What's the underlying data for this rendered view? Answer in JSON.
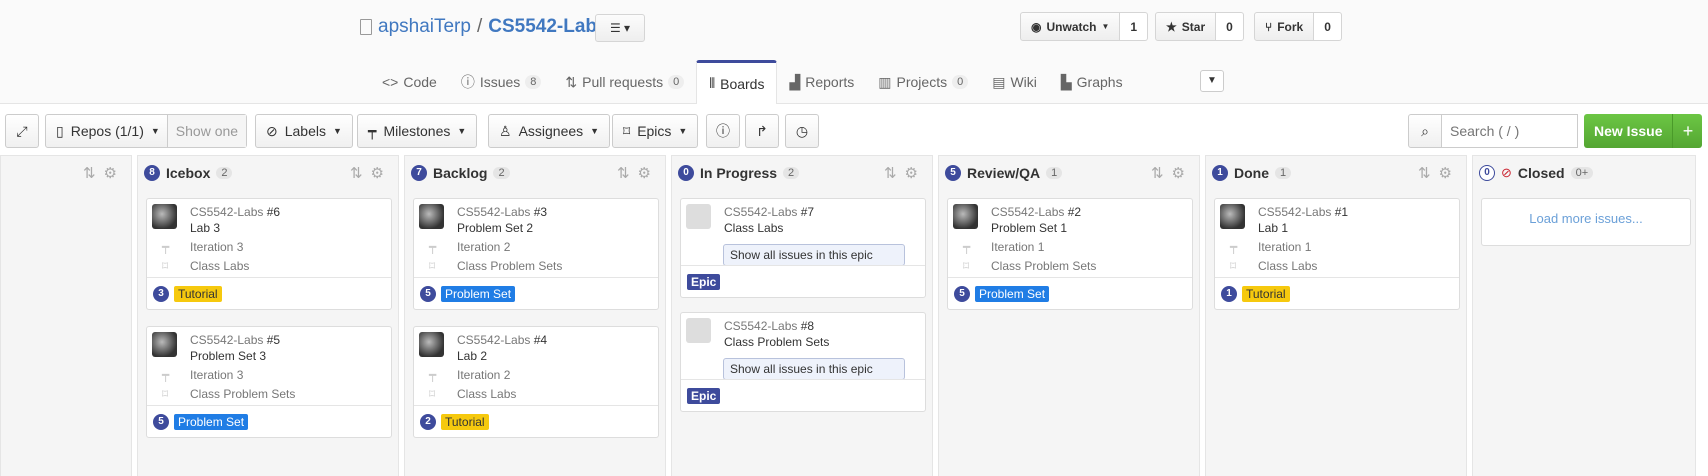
{
  "repo": {
    "owner": "apshaiTerp",
    "sep": "/",
    "name": "CS5542-Labs"
  },
  "social": {
    "watch": {
      "label": "Unwatch",
      "count": "1"
    },
    "star": {
      "label": "Star",
      "count": "0"
    },
    "fork": {
      "label": "Fork",
      "count": "0"
    }
  },
  "tabs": [
    {
      "label": "Code",
      "count": ""
    },
    {
      "label": "Issues",
      "count": "8"
    },
    {
      "label": "Pull requests",
      "count": "0"
    },
    {
      "label": "Boards",
      "count": ""
    },
    {
      "label": "Reports",
      "count": ""
    },
    {
      "label": "Projects",
      "count": "0"
    },
    {
      "label": "Wiki",
      "count": ""
    },
    {
      "label": "Graphs",
      "count": ""
    }
  ],
  "toolbar": {
    "repos": "Repos (1/1)",
    "show_one": "Show one",
    "labels": "Labels",
    "milestones": "Milestones",
    "assignees": "Assignees",
    "epics": "Epics",
    "search_placeholder": "Search ( / )",
    "new_issue": "New Issue",
    "plus": "+"
  },
  "columns": [
    {
      "num": "8",
      "name": "Icebox",
      "count": "2"
    },
    {
      "num": "7",
      "name": "Backlog",
      "count": "2"
    },
    {
      "num": "0",
      "name": "In Progress",
      "count": "2"
    },
    {
      "num": "5",
      "name": "Review/QA",
      "count": "1"
    },
    {
      "num": "1",
      "name": "Done",
      "count": "1"
    },
    {
      "num": "0",
      "name": "Closed",
      "count": "0+"
    }
  ],
  "cards": {
    "icebox1": {
      "repo": "CS5542-Labs",
      "num": "#6",
      "title": "Lab 3",
      "iteration": "Iteration 3",
      "epic": "Class Labs",
      "pts": "3",
      "label": "Tutorial"
    },
    "icebox2": {
      "repo": "CS5542-Labs",
      "num": "#5",
      "title": "Problem Set 3",
      "iteration": "Iteration 3",
      "epic": "Class Problem Sets",
      "pts": "5",
      "label": "Problem Set"
    },
    "backlog1": {
      "repo": "CS5542-Labs",
      "num": "#3",
      "title": "Problem Set 2",
      "iteration": "Iteration 2",
      "epic": "Class Problem Sets",
      "pts": "5",
      "label": "Problem Set"
    },
    "backlog2": {
      "repo": "CS5542-Labs",
      "num": "#4",
      "title": "Lab 2",
      "iteration": "Iteration 2",
      "epic": "Class Labs",
      "pts": "2",
      "label": "Tutorial"
    },
    "prog1": {
      "repo": "CS5542-Labs",
      "num": "#7",
      "title": "Class Labs",
      "button": "Show all issues in this epic",
      "label": "Epic"
    },
    "prog2": {
      "repo": "CS5542-Labs",
      "num": "#8",
      "title": "Class Problem Sets",
      "button": "Show all issues in this epic",
      "label": "Epic"
    },
    "review1": {
      "repo": "CS5542-Labs",
      "num": "#2",
      "title": "Problem Set 1",
      "iteration": "Iteration 1",
      "epic": "Class Problem Sets",
      "pts": "5",
      "label": "Problem Set"
    },
    "done1": {
      "repo": "CS5542-Labs",
      "num": "#1",
      "title": "Lab 1",
      "iteration": "Iteration 1",
      "epic": "Class Labs",
      "pts": "1",
      "label": "Tutorial"
    }
  },
  "load_more": "Load more issues...",
  "colors": {
    "tutorial": "#f6c90e",
    "problem_set": "#207de5",
    "epic": "#3e4b9c",
    "accent": "#4078c0"
  }
}
